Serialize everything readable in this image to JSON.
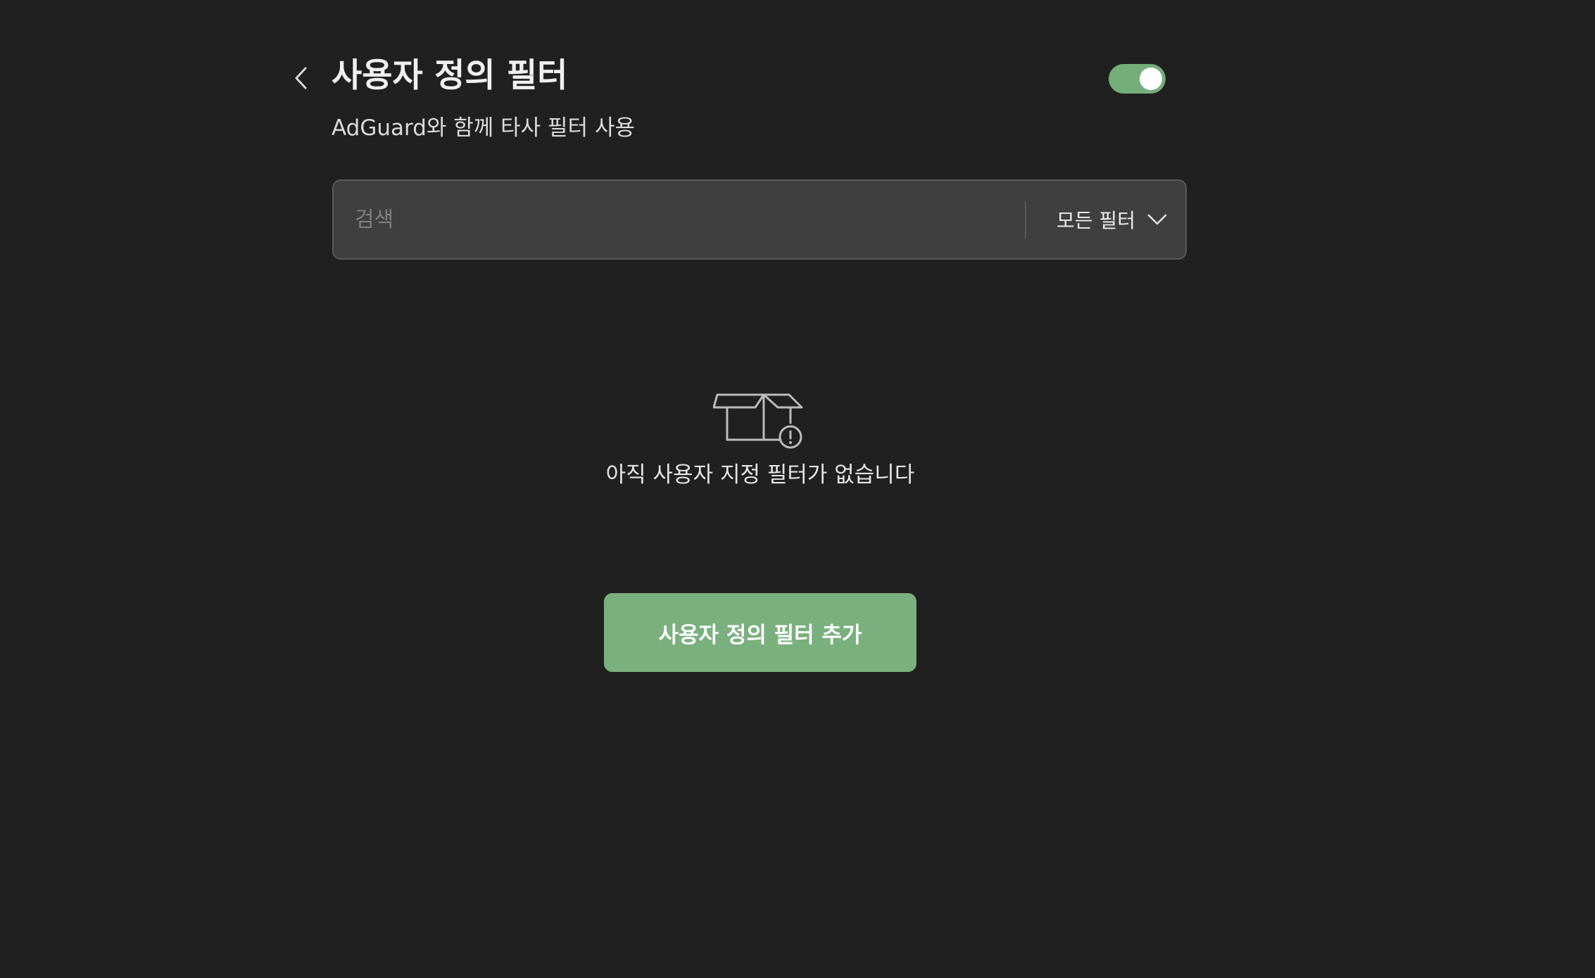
{
  "header": {
    "back_icon": "chevron-left-icon",
    "title": "사용자 정의 필터",
    "subtitle": "AdGuard와 함께 타사 필터 사용",
    "toggle_enabled": true
  },
  "search": {
    "value": "",
    "placeholder": "검색",
    "filter_select": {
      "selected": "모든 필터",
      "icon": "chevron-down-icon"
    }
  },
  "empty_state": {
    "icon": "empty-box-icon",
    "message": "아직 사용자 지정 필터가 없습니다"
  },
  "actions": {
    "add_filter_label": "사용자 정의 필터 추가"
  },
  "colors": {
    "background": "#202020",
    "accent": "#7ab07d",
    "toggle_on": "#75ae78",
    "search_background": "#3f3f3f"
  }
}
